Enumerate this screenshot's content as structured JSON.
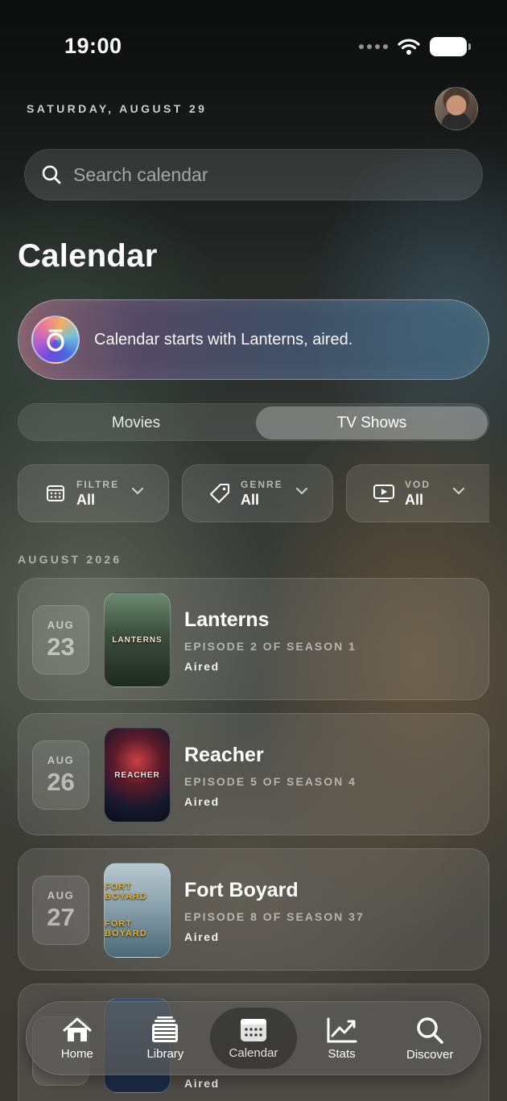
{
  "status_bar": {
    "time": "19:00"
  },
  "header": {
    "date": "SATURDAY, AUGUST 29"
  },
  "search": {
    "placeholder": "Search calendar"
  },
  "page": {
    "title": "Calendar"
  },
  "assistant": {
    "message": "Calendar starts with Lanterns, aired."
  },
  "segments": {
    "movies": "Movies",
    "tv_shows": "TV Shows",
    "selected": "TV Shows"
  },
  "filters": [
    {
      "label": "FILTRE",
      "value": "All",
      "icon": "calendar-grid-icon"
    },
    {
      "label": "GENRE",
      "value": "All",
      "icon": "tag-icon"
    },
    {
      "label": "VOD",
      "value": "All",
      "icon": "tv-play-icon"
    }
  ],
  "section": {
    "label": "AUGUST 2026"
  },
  "episodes": [
    {
      "month": "AUG",
      "day": "23",
      "title": "Lanterns",
      "episode": "EPISODE 2 OF SEASON 1",
      "status": "Aired",
      "poster_text": "LANTERNS"
    },
    {
      "month": "AUG",
      "day": "26",
      "title": "Reacher",
      "episode": "EPISODE 5 OF SEASON 4",
      "status": "Aired",
      "poster_text": "REACHER"
    },
    {
      "month": "AUG",
      "day": "27",
      "title": "Fort Boyard",
      "episode": "EPISODE 8 OF SEASON 37",
      "status": "Aired",
      "poster_text": "FORT BOYARD"
    },
    {
      "status": "Aired"
    }
  ],
  "tabbar": {
    "home": "Home",
    "library": "Library",
    "calendar": "Calendar",
    "stats": "Stats",
    "discover": "Discover",
    "active": "Calendar"
  }
}
